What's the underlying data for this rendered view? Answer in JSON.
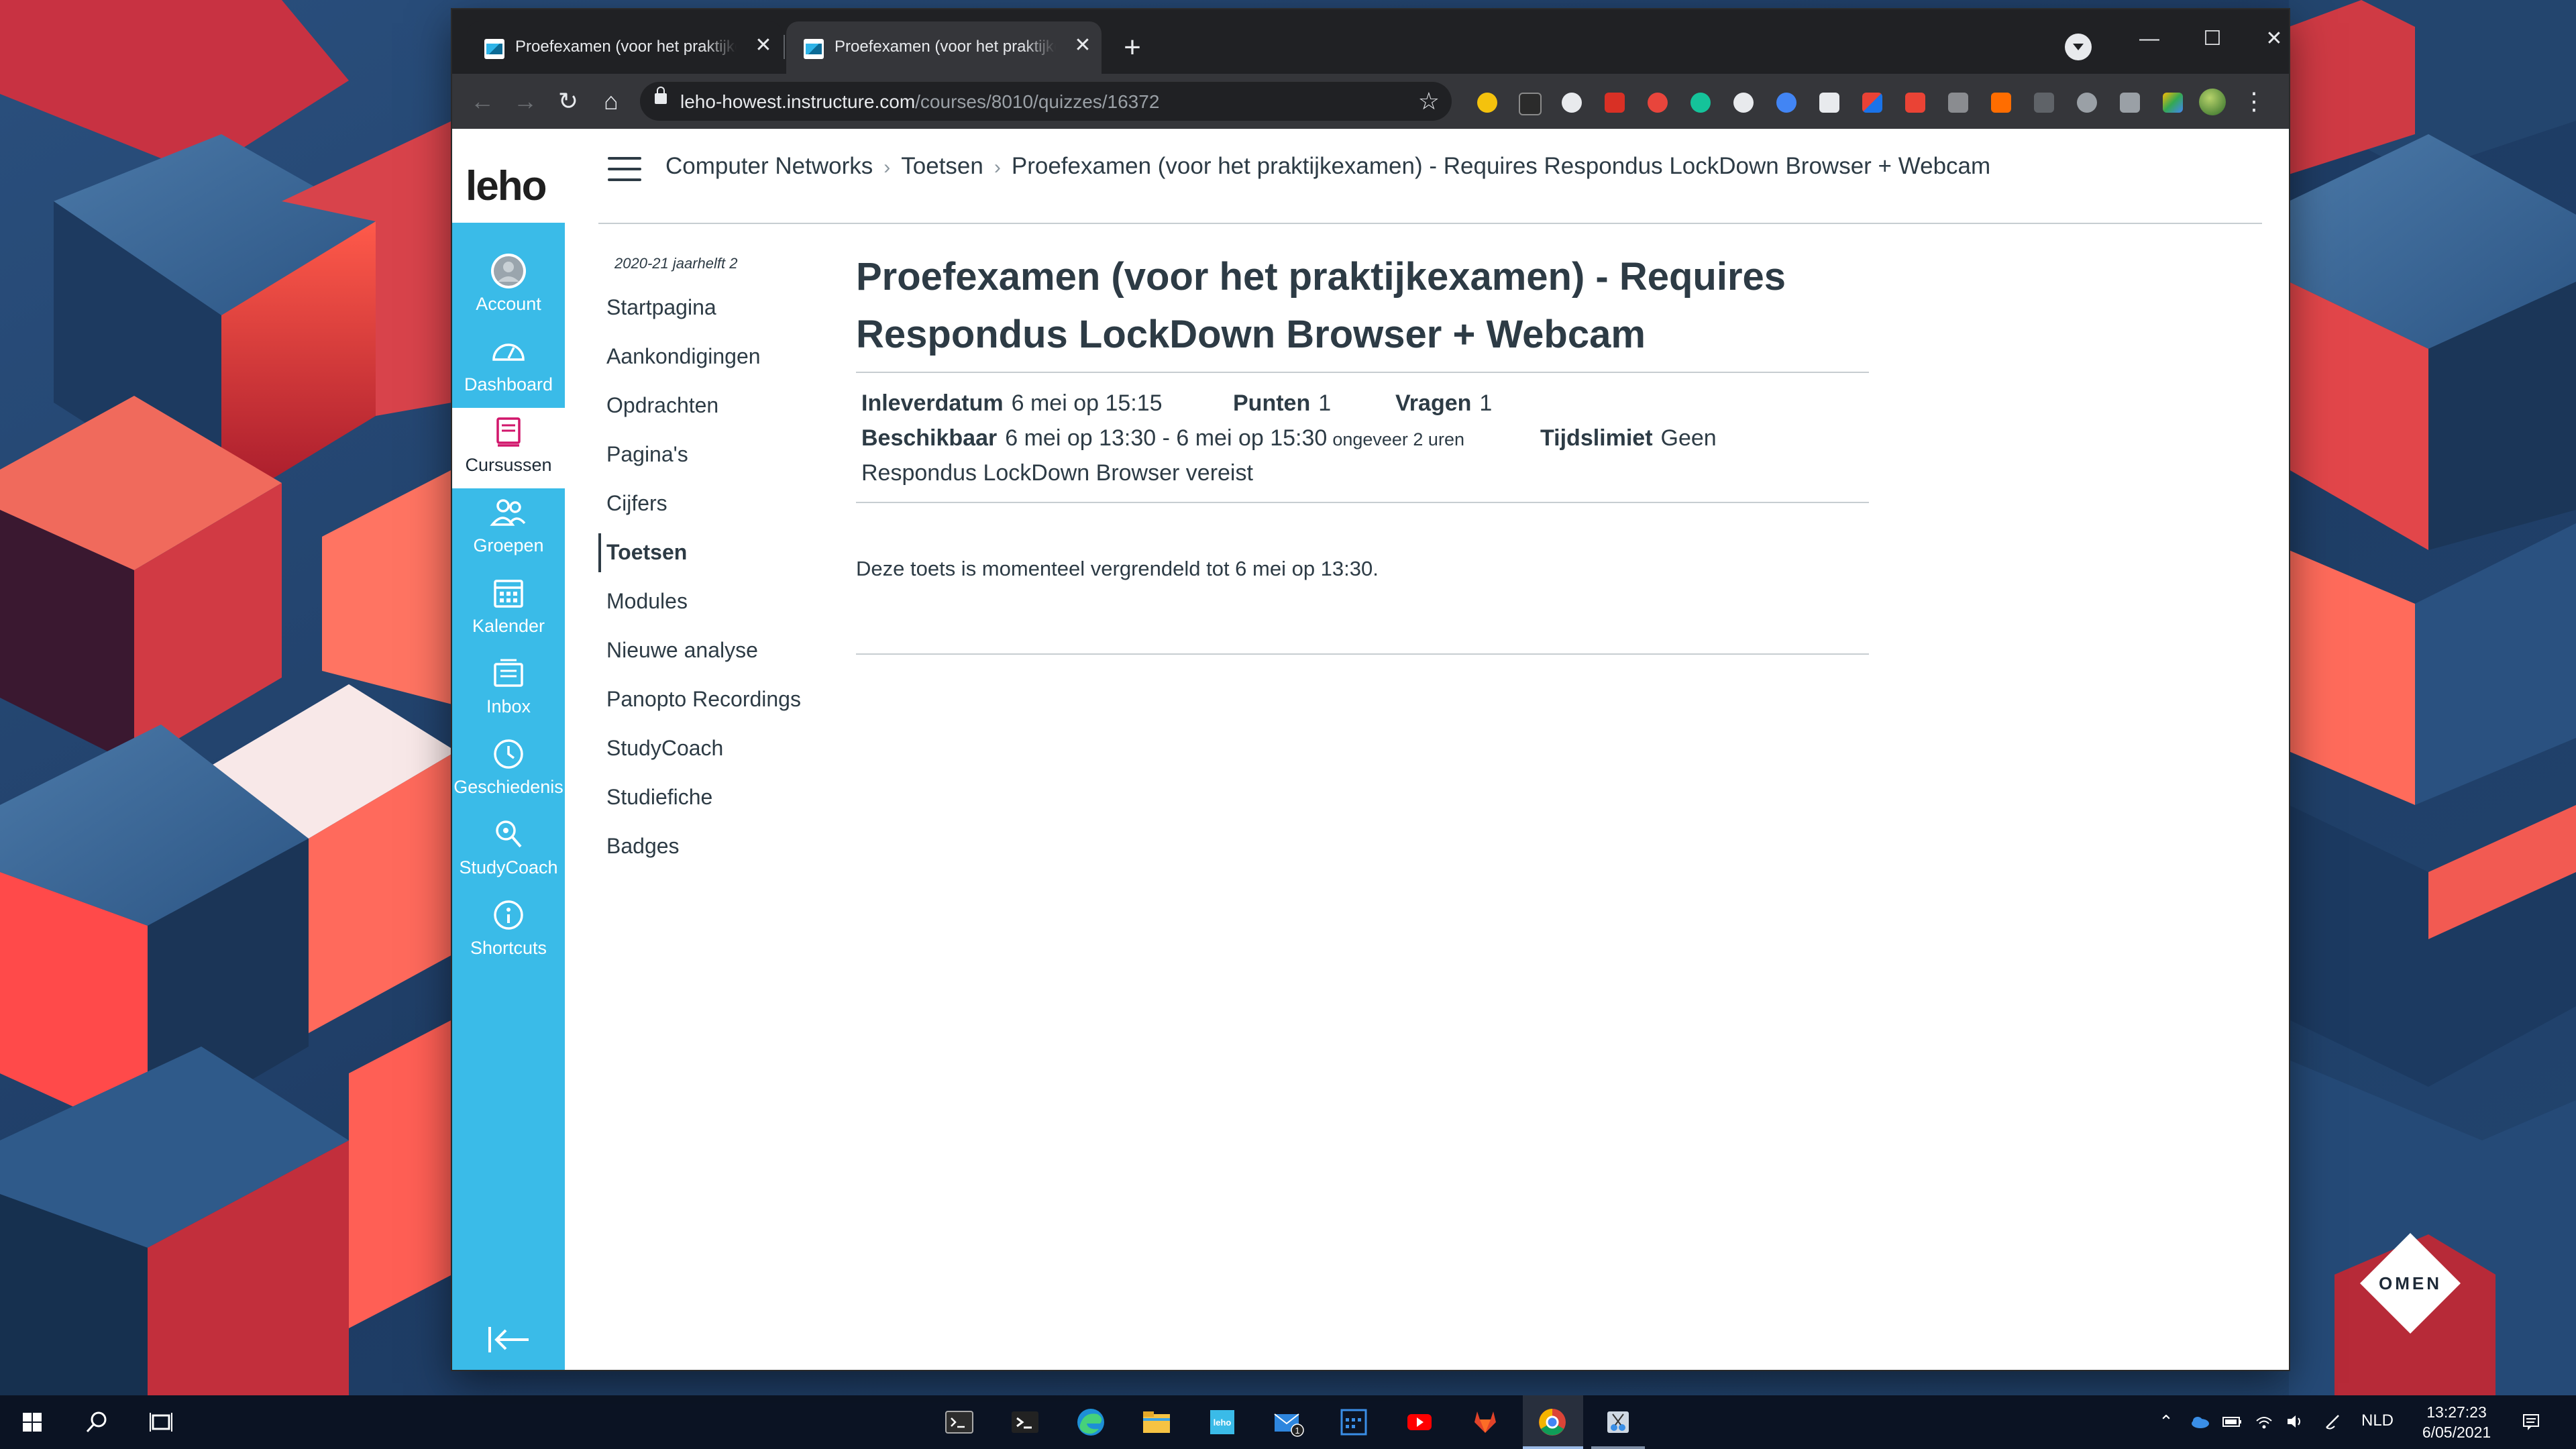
{
  "browser": {
    "tabs": [
      {
        "title": "Proefexamen (voor het praktijkexamen)",
        "active": false
      },
      {
        "title": "Proefexamen (voor het praktijkexamen)",
        "active": true
      }
    ],
    "url_host": "leho-howest.instructure.com",
    "url_path": "/courses/8010/quizzes/16372",
    "new_tab_symbol": "+",
    "close_symbol": "✕",
    "window_controls": {
      "minimize": "—",
      "maximize": "☐",
      "close": "✕"
    }
  },
  "lms": {
    "logo": "leho",
    "global_nav": [
      {
        "label": "Account",
        "icon": "account-avatar-icon"
      },
      {
        "label": "Dashboard",
        "icon": "dashboard-gauge-icon"
      },
      {
        "label": "Cursussen",
        "icon": "courses-book-icon"
      },
      {
        "label": "Groepen",
        "icon": "groups-icon"
      },
      {
        "label": "Kalender",
        "icon": "calendar-icon"
      },
      {
        "label": "Inbox",
        "icon": "inbox-icon"
      },
      {
        "label": "Geschiedenis",
        "icon": "history-clock-icon"
      },
      {
        "label": "StudyCoach",
        "icon": "studycoach-icon"
      },
      {
        "label": "Shortcuts",
        "icon": "shortcuts-icon"
      }
    ],
    "breadcrumb": [
      "Computer Networks",
      "Toetsen",
      "Proefexamen (voor het praktijkexamen) - Requires Respondus LockDown Browser + Webcam"
    ],
    "breadcrumb_sep": "›",
    "course_nav": {
      "term": "2020-21 jaarhelft 2",
      "items": [
        "Startpagina",
        "Aankondigingen",
        "Opdrachten",
        "Pagina's",
        "Cijfers",
        "Toetsen",
        "Modules",
        "Nieuwe analyse",
        "Panopto Recordings",
        "StudyCoach",
        "Studiefiche",
        "Badges"
      ],
      "active": "Toetsen"
    },
    "quiz": {
      "title": "Proefexamen (voor het praktijkexamen) - Requires Respondus LockDown Browser + Webcam",
      "due_label": "Inleverdatum",
      "due_value": "6 mei op 15:15",
      "points_label": "Punten",
      "points_value": "1",
      "questions_label": "Vragen",
      "questions_value": "1",
      "available_label": "Beschikbaar",
      "available_value": "6 mei op 13:30 - 6 mei op 15:30",
      "available_note": "ongeveer 2 uren",
      "time_limit_label": "Tijdslimiet",
      "time_limit_value": "Geen",
      "lockdown_note": "Respondus LockDown Browser vereist",
      "locked_message": "Deze toets is momenteel vergrendeld tot 6 mei op 13:30."
    }
  },
  "desktop": {
    "omen_logo": "OMEN",
    "taskbar": {
      "language": "NLD",
      "time": "13:27:23",
      "date": "6/05/2021",
      "mail_badge": "1",
      "leho_icon_text": "leho"
    }
  },
  "colors": {
    "canvas_nav": "#3abbe8",
    "chrome_dark": "#202124",
    "text": "#2d3b45"
  }
}
